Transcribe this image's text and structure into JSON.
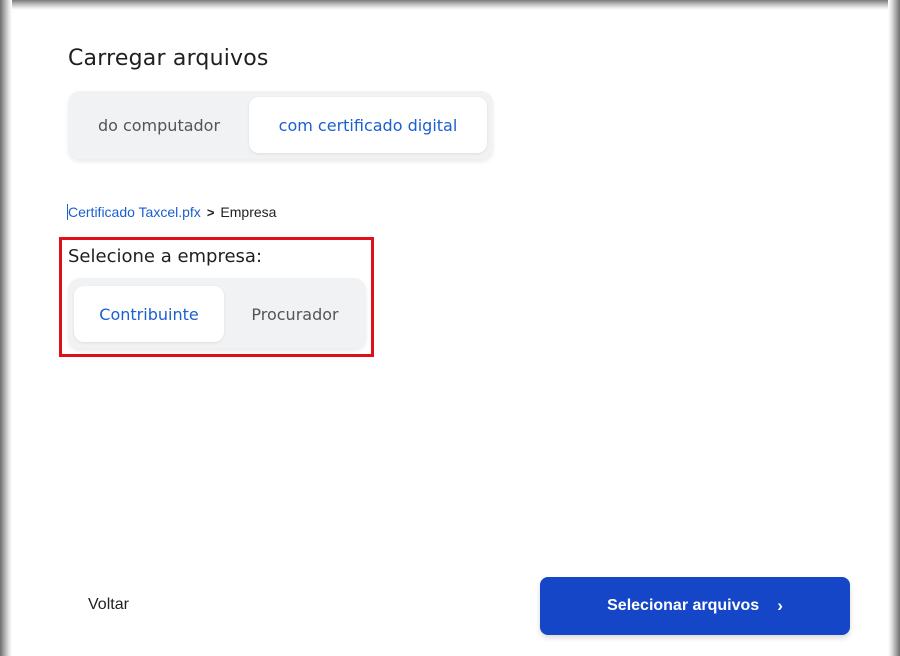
{
  "upload": {
    "title": "Carregar arquivos",
    "tabs": [
      {
        "label": "do computador",
        "active": false
      },
      {
        "label": "com certificado digital",
        "active": true
      }
    ]
  },
  "breadcrumb": {
    "file": "Certificado Taxcel.pfx",
    "separator": ">",
    "current": "Empresa"
  },
  "company": {
    "label": "Selecione a empresa:",
    "options": [
      {
        "label": "Contribuinte",
        "active": true
      },
      {
        "label": "Procurador",
        "active": false
      }
    ]
  },
  "footer": {
    "back_label": "Voltar",
    "primary_label": "Selecionar arquivos",
    "primary_icon": "chevron-right-icon"
  },
  "colors": {
    "accent": "#1b5fd0",
    "primary_button": "#1446c7",
    "highlight_border": "#e0101a",
    "segment_bg": "#f1f2f4"
  }
}
